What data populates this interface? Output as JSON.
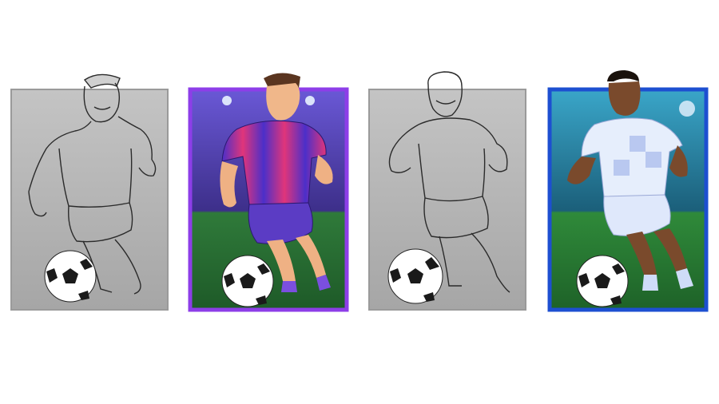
{
  "cards": [
    {
      "id": "card-1",
      "kind": "sketch",
      "player": "player-1",
      "frame_color": "#a9a9a9",
      "bg_color": "#b8b8b8"
    },
    {
      "id": "card-2",
      "kind": "colored",
      "player": "player-1",
      "frame_color": "#7b2fd6",
      "bg_color": "#5a3fb0",
      "jersey_colors": [
        "#4b2fc9",
        "#e0357a"
      ],
      "shorts_color": "#5b3cc4"
    },
    {
      "id": "card-3",
      "kind": "sketch",
      "player": "player-2",
      "frame_color": "#a9a9a9",
      "bg_color": "#b8b8b8"
    },
    {
      "id": "card-4",
      "kind": "colored",
      "player": "player-2",
      "frame_color": "#1d4fd1",
      "bg_color": "#1f6a8a",
      "jersey_colors": [
        "#e6eefc",
        "#b9c8f0"
      ],
      "shorts_color": "#dfe8fb"
    }
  ],
  "icons": {
    "ball": "soccer-ball-icon"
  }
}
